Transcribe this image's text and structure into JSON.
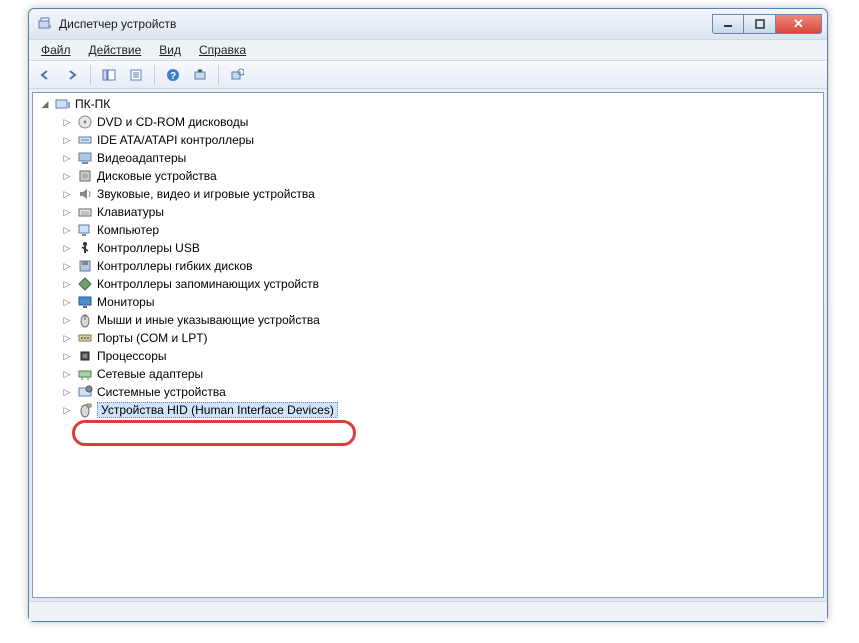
{
  "window": {
    "title": "Диспетчер устройств"
  },
  "menu": {
    "file": "Файл",
    "action": "Действие",
    "view": "Вид",
    "help": "Справка"
  },
  "tree": {
    "root": "ПК-ПК",
    "items": [
      "DVD и CD-ROM дисководы",
      "IDE ATA/ATAPI контроллеры",
      "Видеоадаптеры",
      "Дисковые устройства",
      "Звуковые, видео и игровые устройства",
      "Клавиатуры",
      "Компьютер",
      "Контроллеры USB",
      "Контроллеры гибких дисков",
      "Контроллеры запоминающих устройств",
      "Мониторы",
      "Мыши и иные указывающие устройства",
      "Порты (COM и LPT)",
      "Процессоры",
      "Сетевые адаптеры",
      "Системные устройства",
      "Устройства HID (Human Interface Devices)"
    ],
    "selected_index": 16
  },
  "icons": {
    "dvd": "💿",
    "ide": "🔌",
    "video": "🖥️",
    "disk": "💽",
    "sound": "🔊",
    "keyboard": "⌨️",
    "computer": "🖥️",
    "usb": "🔌",
    "floppy": "💾",
    "storage": "◈",
    "monitor": "🖵",
    "mouse": "🖱️",
    "ports": "🔌",
    "cpu": "▣",
    "network": "🖧",
    "system": "⚙️",
    "hid": "🖱️",
    "pc": "🖥️"
  }
}
